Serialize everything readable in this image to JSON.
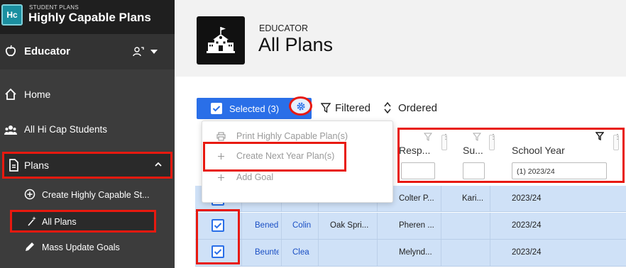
{
  "brand": {
    "logo": "Hc",
    "subtitle": "STUDENT PLANS",
    "title": "Highly Capable Plans"
  },
  "role": {
    "label": "Educator"
  },
  "nav": {
    "home": "Home",
    "students": "All Hi Cap Students",
    "plans": "Plans",
    "sub": {
      "create": "Create Highly Capable St...",
      "all_plans": "All Plans",
      "mass_update": "Mass Update Goals"
    }
  },
  "header": {
    "eyebrow": "EDUCATOR",
    "title": "All Plans"
  },
  "toolbar": {
    "selected_label": "Selected (3)",
    "filtered_label": "Filtered",
    "ordered_label": "Ordered"
  },
  "menu": {
    "items": [
      {
        "label": "Print Highly Capable Plan(s)",
        "icon": "printer-icon"
      },
      {
        "label": "Create Next Year Plan(s)",
        "icon": "plus-icon"
      },
      {
        "label": "Add Goal",
        "icon": "plus-icon"
      }
    ]
  },
  "table": {
    "columns": {
      "responsible": "Resp...",
      "support": "Su...",
      "school_year": "School Year"
    },
    "filters": {
      "school_year": "(1) 2023/24"
    },
    "rows": [
      {
        "last": "...",
        "first": "...",
        "school": "...",
        "responsible": "Colter P...",
        "support": "Kari...",
        "year": "2023/24",
        "checked": true
      },
      {
        "last": "Bened",
        "first": "Colin",
        "school": "Oak Spri...",
        "responsible": "Pheren ...",
        "support": "",
        "year": "2023/24",
        "checked": true
      },
      {
        "last": "Beunte",
        "first": "Clea",
        "school": "",
        "responsible": "Melynd...",
        "support": "",
        "year": "2023/24",
        "checked": true
      }
    ]
  },
  "colors": {
    "accent": "#2a6fe8",
    "highlight": "#e8190f",
    "row_selected": "#cfe1f7",
    "sidebar": "#3c3c3c"
  }
}
